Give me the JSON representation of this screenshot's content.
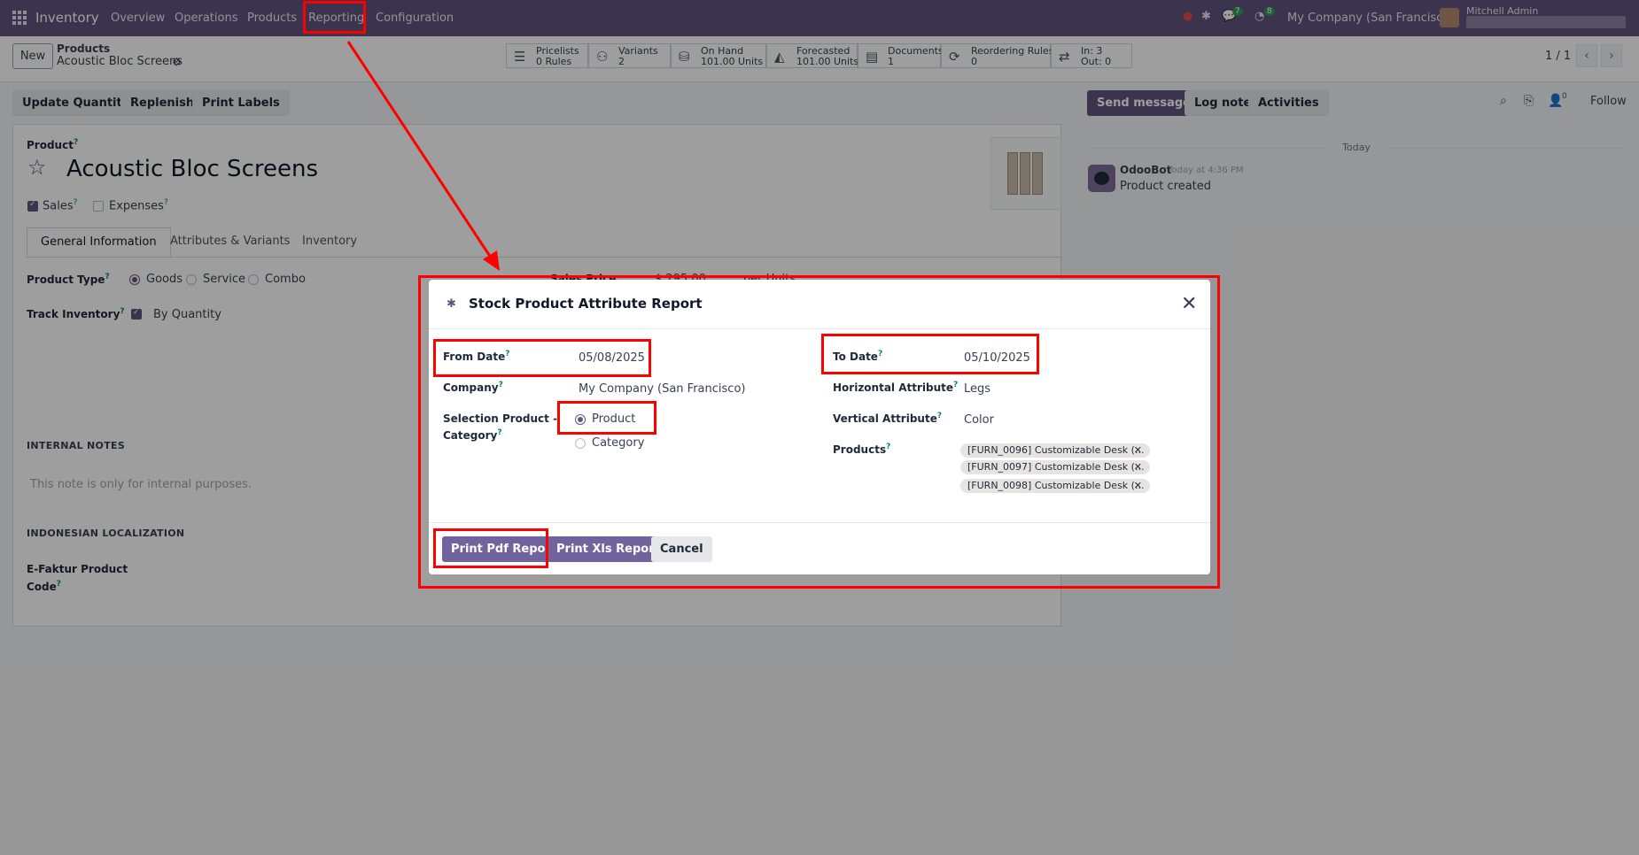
{
  "navbar": {
    "brand": "Inventory",
    "menu": [
      "Overview",
      "Operations",
      "Products",
      "Reporting",
      "Configuration"
    ],
    "company": "My Company (San Francisco)",
    "user": "Mitchell Admin",
    "badges": {
      "messages": "7",
      "activities": "8"
    }
  },
  "control": {
    "new_label": "New",
    "breadcrumb_parent": "Products",
    "breadcrumb_current": "Acoustic Bloc Screens",
    "pager": "1 / 1",
    "smart_buttons": [
      {
        "icon": "list-icon",
        "glyph": "☰",
        "line1": "Pricelists",
        "line2": "0 Rules"
      },
      {
        "icon": "sitemap-icon",
        "glyph": "⚇",
        "line1": "Variants",
        "line2": "2"
      },
      {
        "icon": "cubes-icon",
        "glyph": "⛁",
        "line1": "On Hand",
        "line2": "101.00 Units"
      },
      {
        "icon": "area-chart-icon",
        "glyph": "◭",
        "line1": "Forecasted",
        "line2": "101.00 Units"
      },
      {
        "icon": "document-icon",
        "glyph": "▤",
        "line1": "Documents",
        "line2": "1"
      },
      {
        "icon": "refresh-icon",
        "glyph": "⟳",
        "line1": "Reordering Rules",
        "line2": "0"
      },
      {
        "icon": "exchange-icon",
        "glyph": "⇄",
        "line1": "In: 3",
        "line2": "Out: 0"
      }
    ]
  },
  "actions": {
    "update_quantity": "Update Quantity",
    "replenish": "Replenish",
    "print_labels": "Print Labels",
    "send_message": "Send message",
    "log_note": "Log note",
    "activities": "Activities",
    "follow": "Follow",
    "followers_count": "0"
  },
  "form": {
    "product_label": "Product",
    "product_name": "Acoustic Bloc Screens",
    "sales_label": "Sales",
    "expenses_label": "Expenses",
    "tabs": [
      "General Information",
      "Attributes & Variants",
      "Inventory"
    ],
    "product_type_label": "Product Type",
    "product_type_options": [
      "Goods",
      "Service",
      "Combo"
    ],
    "track_inventory_label": "Track Inventory",
    "track_inventory_value": "By Quantity",
    "sales_price_label": "Sales Price",
    "sales_price_value": "$ 295.00",
    "sales_price_uom": "per Units",
    "internal_notes_header": "INTERNAL NOTES",
    "internal_notes_placeholder": "This note is only for internal purposes.",
    "indonesian_header": "INDONESIAN LOCALIZATION",
    "efaktur_label_1": "E-Faktur Product",
    "efaktur_label_2": "Code"
  },
  "chatter": {
    "today": "Today",
    "author": "OdooBot",
    "time": "Today at 4:36 PM",
    "message": "Product created"
  },
  "modal": {
    "title": "Stock Product Attribute Report",
    "from_date_label": "From Date",
    "from_date": "05/08/2025",
    "to_date_label": "To Date",
    "to_date": "05/10/2025",
    "company_label": "Company",
    "company": "My Company (San Francisco)",
    "horizontal_attr_label": "Horizontal Attribute",
    "horizontal_attr": "Legs",
    "selection_label_1": "Selection Product -",
    "selection_label_2": "Category",
    "selection_options": [
      "Product",
      "Category"
    ],
    "vertical_attr_label": "Vertical Attribute",
    "vertical_attr": "Color",
    "products_label": "Products",
    "products": [
      "[FURN_0096] Customizable Desk (...",
      "[FURN_0097] Customizable Desk (...",
      "[FURN_0098] Customizable Desk (..."
    ],
    "print_pdf": "Print Pdf Report",
    "print_xls": "Print Xls Report",
    "cancel": "Cancel"
  },
  "colors": {
    "brand": "#61547f",
    "annotation": "#ff0000"
  }
}
